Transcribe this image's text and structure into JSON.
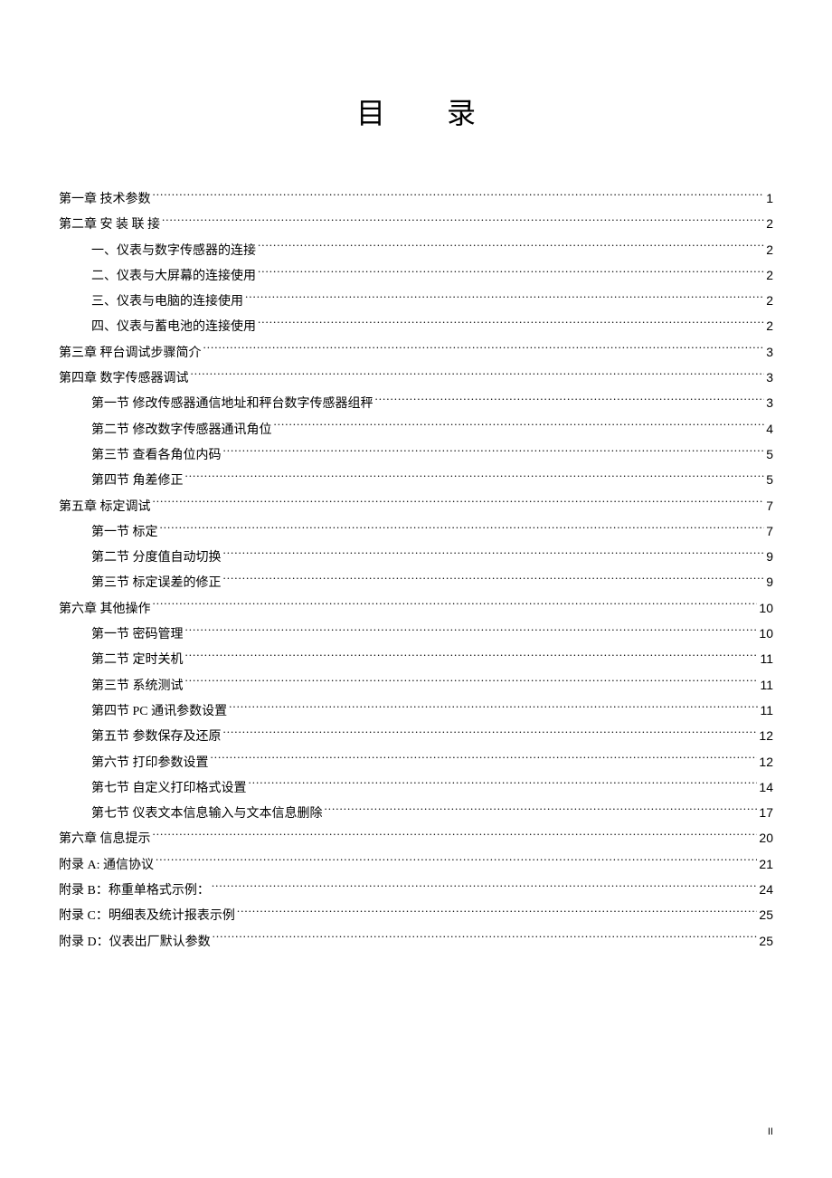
{
  "title": "目 录",
  "page_footer": "II",
  "toc": [
    {
      "indent": 0,
      "label": "第一章  技术参数",
      "page": "1"
    },
    {
      "indent": 0,
      "label": "第二章  安 装 联 接",
      "page": "2"
    },
    {
      "indent": 1,
      "label": "一、仪表与数字传感器的连接",
      "page": "2"
    },
    {
      "indent": 1,
      "label": "二、仪表与大屏幕的连接使用",
      "page": "2"
    },
    {
      "indent": 1,
      "label": "三、仪表与电脑的连接使用",
      "page": "2"
    },
    {
      "indent": 1,
      "label": "四、仪表与蓄电池的连接使用",
      "page": "2"
    },
    {
      "indent": 0,
      "label": "第三章  秤台调试步骤简介",
      "page": "3"
    },
    {
      "indent": 0,
      "label": "第四章  数字传感器调试",
      "page": "3"
    },
    {
      "indent": 1,
      "label": "第一节  修改传感器通信地址和秤台数字传感器组秤",
      "page": "3"
    },
    {
      "indent": 1,
      "label": "第二节  修改数字传感器通讯角位",
      "page": "4"
    },
    {
      "indent": 1,
      "label": "第三节  查看各角位内码",
      "page": "5"
    },
    {
      "indent": 1,
      "label": "第四节  角差修正",
      "page": "5"
    },
    {
      "indent": 0,
      "label": "第五章  标定调试",
      "page": "7"
    },
    {
      "indent": 1,
      "label": "第一节 标定",
      "page": "7"
    },
    {
      "indent": 1,
      "label": "第二节 分度值自动切换",
      "page": "9"
    },
    {
      "indent": 1,
      "label": "第三节 标定误差的修正",
      "page": "9"
    },
    {
      "indent": 0,
      "label": "第六章  其他操作",
      "page": "10"
    },
    {
      "indent": 1,
      "label": "第一节 密码管理",
      "page": "10"
    },
    {
      "indent": 1,
      "label": "第二节 定时关机",
      "page": "11"
    },
    {
      "indent": 1,
      "label": "第三节 系统测试",
      "page": "11"
    },
    {
      "indent": 1,
      "label": "第四节 PC 通讯参数设置",
      "page": "11"
    },
    {
      "indent": 1,
      "label": "第五节 参数保存及还原",
      "page": "12"
    },
    {
      "indent": 1,
      "label": "第六节  打印参数设置",
      "page": "12"
    },
    {
      "indent": 1,
      "label": "第七节 自定义打印格式设置",
      "page": "14"
    },
    {
      "indent": 1,
      "label": "第七节 仪表文本信息输入与文本信息删除",
      "page": "17"
    },
    {
      "indent": 0,
      "label": "第六章  信息提示",
      "page": "20"
    },
    {
      "indent": 0,
      "label": "附录 A:  通信协议",
      "page": "21"
    },
    {
      "indent": 0,
      "label": "附录 B：称重单格式示例：",
      "page": "24"
    },
    {
      "indent": 0,
      "label": "附录 C：明细表及统计报表示例",
      "page": "25"
    },
    {
      "indent": 0,
      "label": "附录 D：仪表出厂默认参数",
      "page": "25"
    }
  ]
}
